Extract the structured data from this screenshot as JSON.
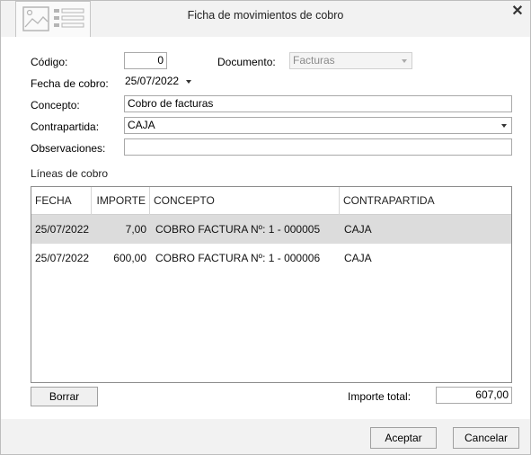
{
  "window": {
    "title": "Ficha de movimientos de cobro",
    "close_label": "✕"
  },
  "form": {
    "codigo_label": "Código:",
    "codigo_value": "0",
    "documento_label": "Documento:",
    "documento_value": "Facturas",
    "fecha_label": "Fecha de cobro:",
    "fecha_value": "25/07/2022",
    "concepto_label": "Concepto:",
    "concepto_value": "Cobro de facturas",
    "contrapartida_label": "Contrapartida:",
    "contrapartida_value": "CAJA",
    "observaciones_label": "Observaciones:",
    "observaciones_value": ""
  },
  "lines": {
    "section_title": "Líneas de cobro",
    "columns": [
      "FECHA",
      "IMPORTE",
      "CONCEPTO",
      "CONTRAPARTIDA"
    ],
    "rows": [
      {
        "fecha": "25/07/2022",
        "importe": "7,00",
        "concepto": "COBRO FACTURA Nº: 1 - 000005",
        "contrapartida": "CAJA"
      },
      {
        "fecha": "25/07/2022",
        "importe": "600,00",
        "concepto": "COBRO FACTURA Nº: 1 - 000006",
        "contrapartida": "CAJA"
      }
    ]
  },
  "bottom": {
    "borrar_label": "Borrar",
    "importe_total_label": "Importe total:",
    "importe_total_value": "607,00"
  },
  "footer": {
    "aceptar_label": "Aceptar",
    "cancelar_label": "Cancelar"
  },
  "colors": {
    "selected_row": "#dcdcdc",
    "chrome": "#f2f2f2"
  }
}
